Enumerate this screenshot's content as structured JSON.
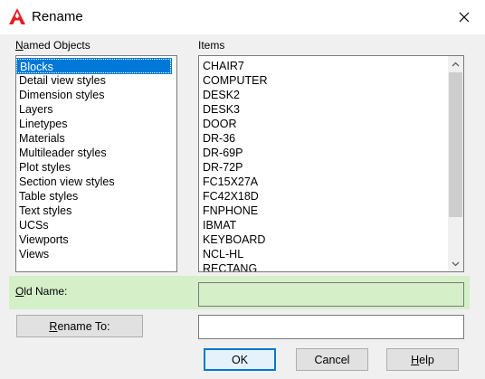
{
  "window": {
    "title": "Rename"
  },
  "named_objects": {
    "label_prefix": "N",
    "label_rest": "amed Objects",
    "items": [
      "Blocks",
      "Detail view styles",
      "Dimension styles",
      "Layers",
      "Linetypes",
      "Materials",
      "Multileader styles",
      "Plot styles",
      "Section view styles",
      "Table styles",
      "Text styles",
      "UCSs",
      "Viewports",
      "Views"
    ],
    "selected": "Blocks"
  },
  "items_list": {
    "label": "Items",
    "items": [
      "CHAIR7",
      "COMPUTER",
      "DESK2",
      "DESK3",
      "DOOR",
      "DR-36",
      "DR-69P",
      "DR-72P",
      "FC15X27A",
      "FC42X18D",
      "FNPHONE",
      "IBMAT",
      "KEYBOARD",
      "NCL-HL",
      "RECTANG"
    ]
  },
  "old_name": {
    "label_prefix": "O",
    "label_rest": "ld Name:",
    "value": ""
  },
  "rename_to": {
    "label_prefix": "R",
    "label_rest": "ename To:",
    "value": ""
  },
  "buttons": {
    "ok": "OK",
    "cancel": "Cancel",
    "help_prefix": "H",
    "help_rest": "elp"
  },
  "colors": {
    "accent": "#0078d7",
    "highlight_band": "#d5efc9",
    "app_icon": "#e31e24"
  },
  "icons": {
    "app": "autocad-a-icon",
    "close": "close-icon",
    "scroll_up": "chevron-up-icon",
    "scroll_down": "chevron-down-icon"
  }
}
